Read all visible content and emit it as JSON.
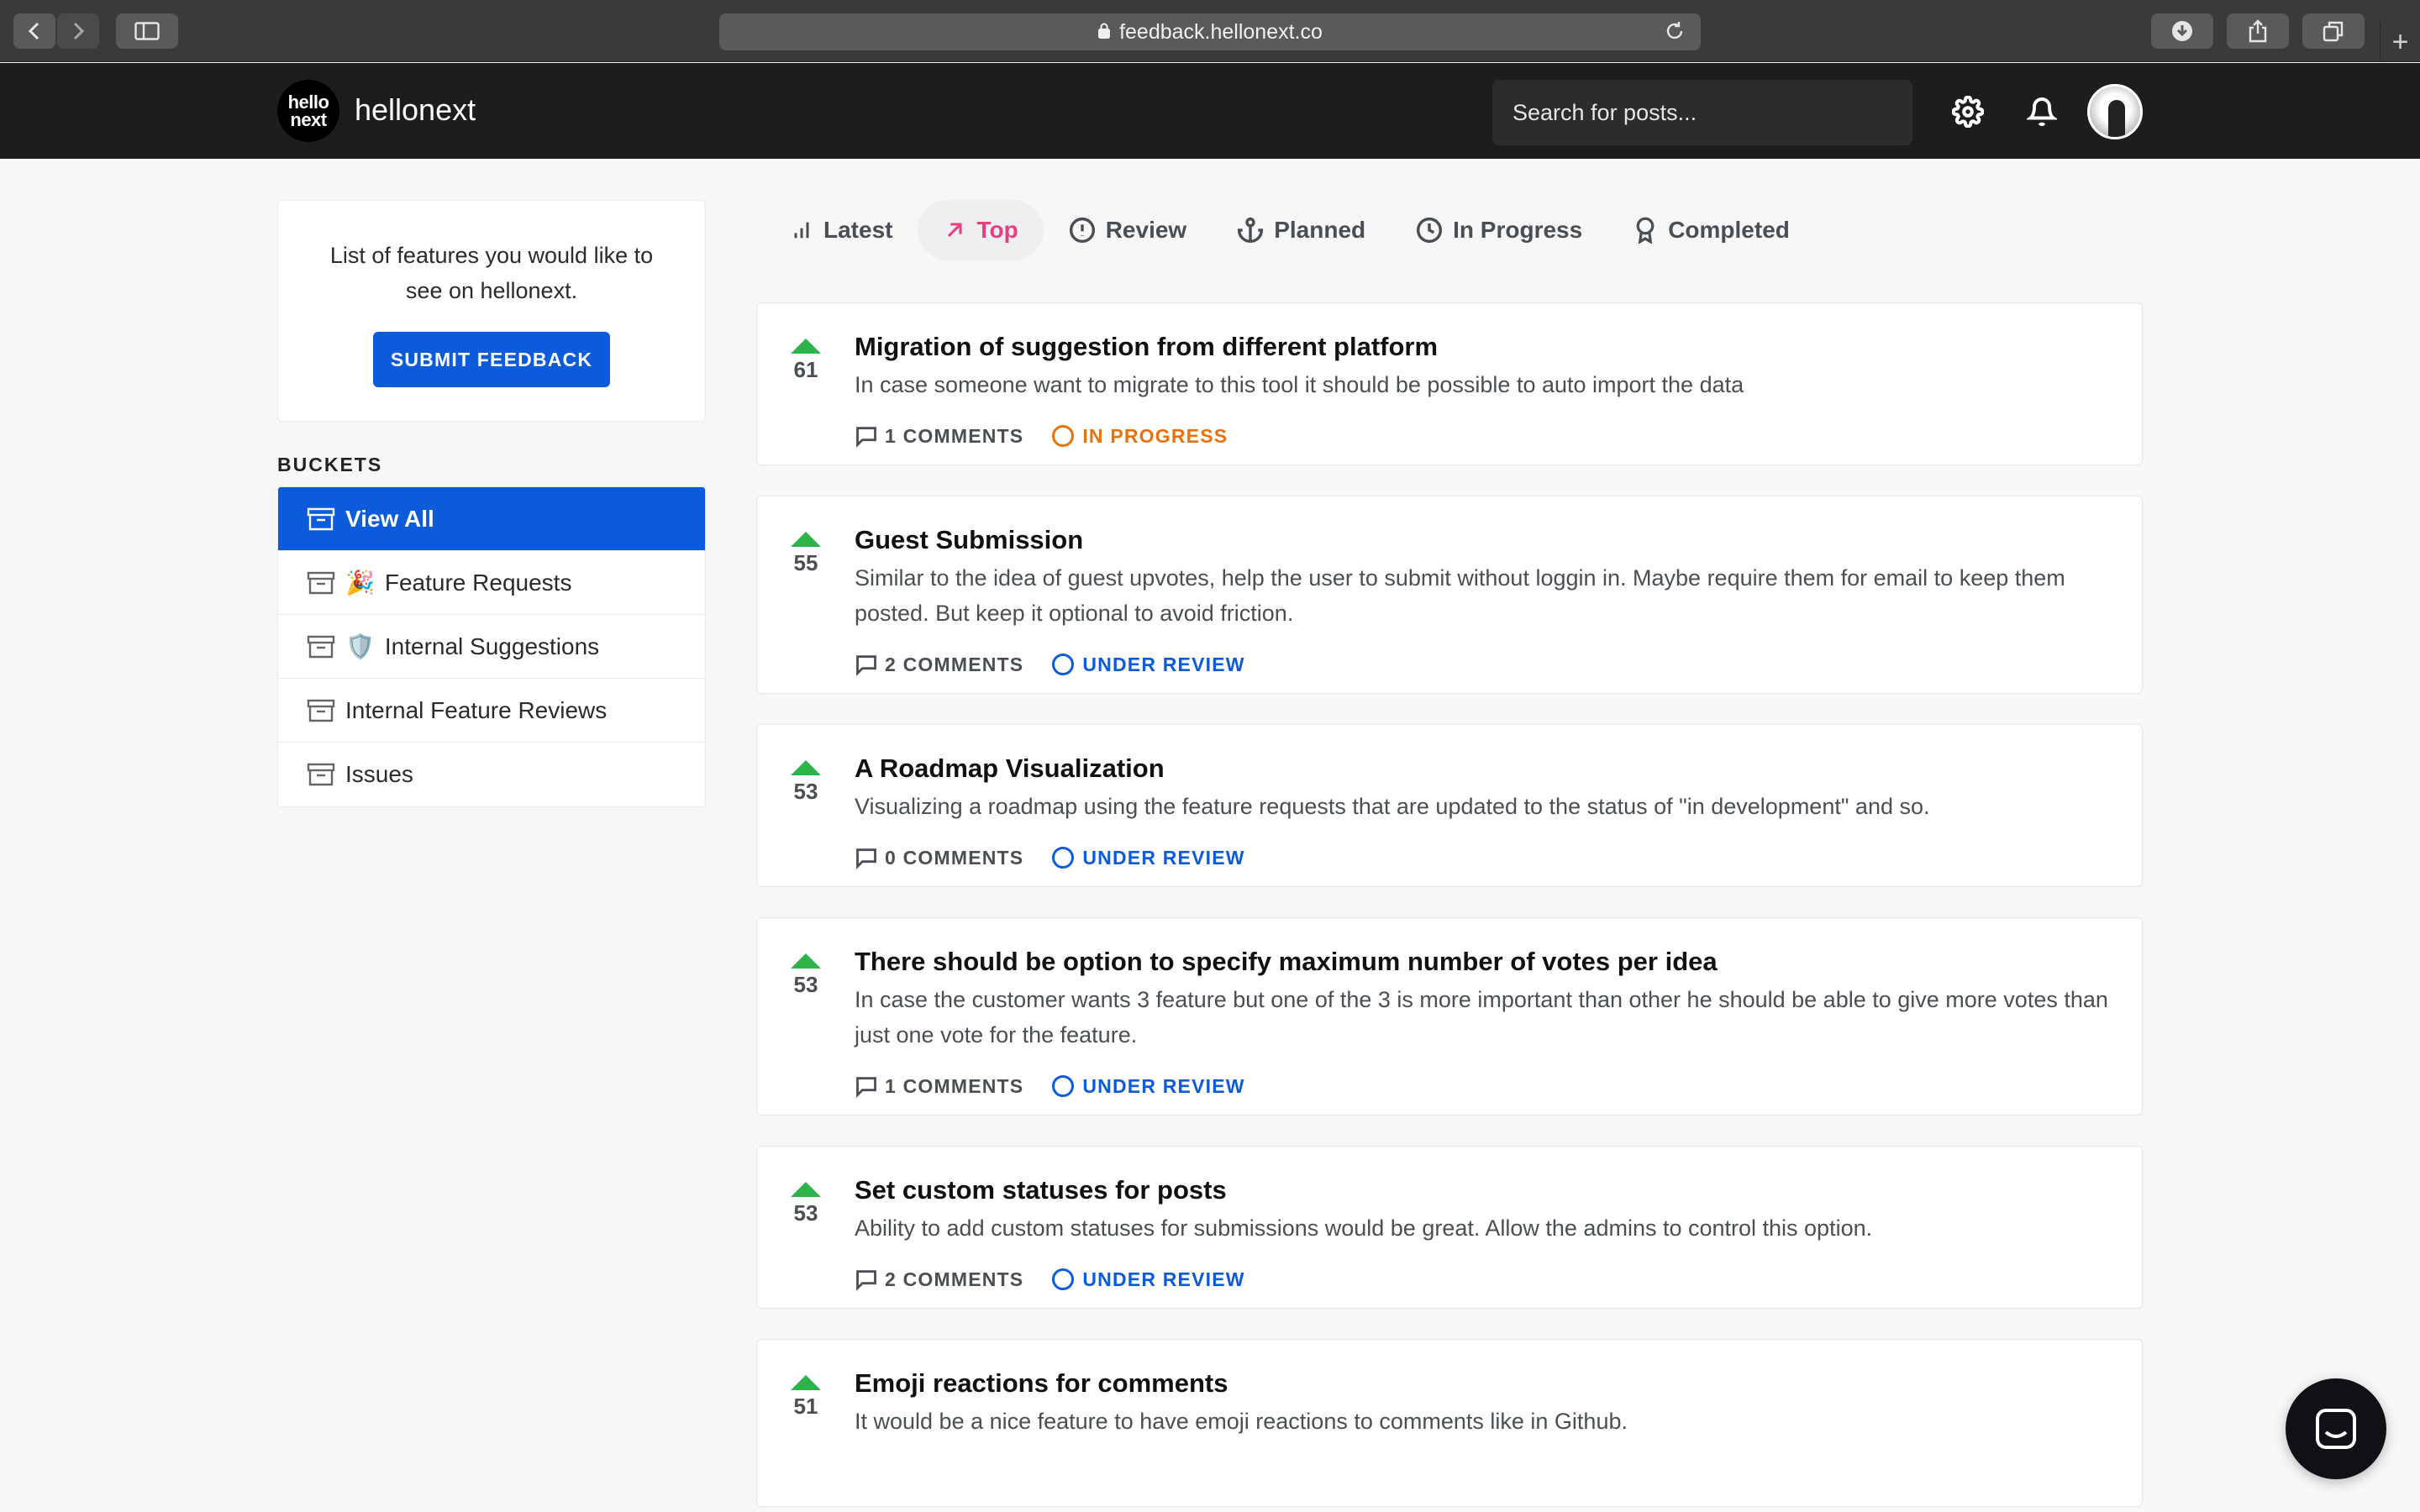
{
  "browser": {
    "url": "feedback.hellonext.co"
  },
  "header": {
    "logo_line1": "hello",
    "logo_line2": "next",
    "brand": "hellonext",
    "search_placeholder": "Search for posts..."
  },
  "sidebar": {
    "intro": "List of features you would like to see on hellonext.",
    "submit_label": "SUBMIT FEEDBACK",
    "buckets_title": "BUCKETS",
    "buckets": [
      {
        "label": "View All",
        "emoji": ""
      },
      {
        "label": "Feature Requests",
        "emoji": "🎉"
      },
      {
        "label": "Internal Suggestions",
        "emoji": "🛡️"
      },
      {
        "label": "Internal Feature Reviews",
        "emoji": ""
      },
      {
        "label": "Issues",
        "emoji": ""
      }
    ]
  },
  "tabs": [
    {
      "label": "Latest",
      "icon": "bar-chart-icon"
    },
    {
      "label": "Top",
      "icon": "arrow-up-right-icon"
    },
    {
      "label": "Review",
      "icon": "alert-circle-icon"
    },
    {
      "label": "Planned",
      "icon": "anchor-icon"
    },
    {
      "label": "In Progress",
      "icon": "clock-icon"
    },
    {
      "label": "Completed",
      "icon": "award-icon"
    }
  ],
  "posts": [
    {
      "votes": "61",
      "title": "Migration of suggestion from different platform",
      "description": "In case someone want to migrate to this tool it should be possible to auto import the data",
      "comments": "1 COMMENTS",
      "status": "IN PROGRESS",
      "status_color": "#e8720c"
    },
    {
      "votes": "55",
      "title": "Guest Submission",
      "description": "Similar to the idea of guest upvotes, help the user to submit without loggin in. Maybe require them for email to keep them posted. But keep it optional to avoid friction.",
      "comments": "2 COMMENTS",
      "status": "UNDER REVIEW",
      "status_color": "#0b5bdb"
    },
    {
      "votes": "53",
      "title": "A Roadmap Visualization",
      "description": "Visualizing a roadmap using the feature requests that are updated to the status of \"in development\" and so.",
      "comments": "0 COMMENTS",
      "status": "UNDER REVIEW",
      "status_color": "#0b5bdb"
    },
    {
      "votes": "53",
      "title": "There should be option to specify maximum number of votes per idea",
      "description": "In case the customer wants 3 feature but one of the 3 is more important than other he should be able to give more votes than just one vote for the feature.",
      "comments": "1 COMMENTS",
      "status": "UNDER REVIEW",
      "status_color": "#0b5bdb"
    },
    {
      "votes": "53",
      "title": "Set custom statuses for posts",
      "description": "Ability to add custom statuses for submissions would be great. Allow the admins to control this option.",
      "comments": "2 COMMENTS",
      "status": "UNDER REVIEW",
      "status_color": "#0b5bdb"
    },
    {
      "votes": "51",
      "title": "Emoji reactions for comments",
      "description": "It would be a nice feature to have emoji reactions to comments like in Github.",
      "comments": "",
      "status": "",
      "status_color": "#0b5bdb"
    }
  ],
  "colors": {
    "primary": "#0b5bdb",
    "active_tab": "#e8407d",
    "upvote": "#2eb24a",
    "in_progress": "#e8720c"
  }
}
